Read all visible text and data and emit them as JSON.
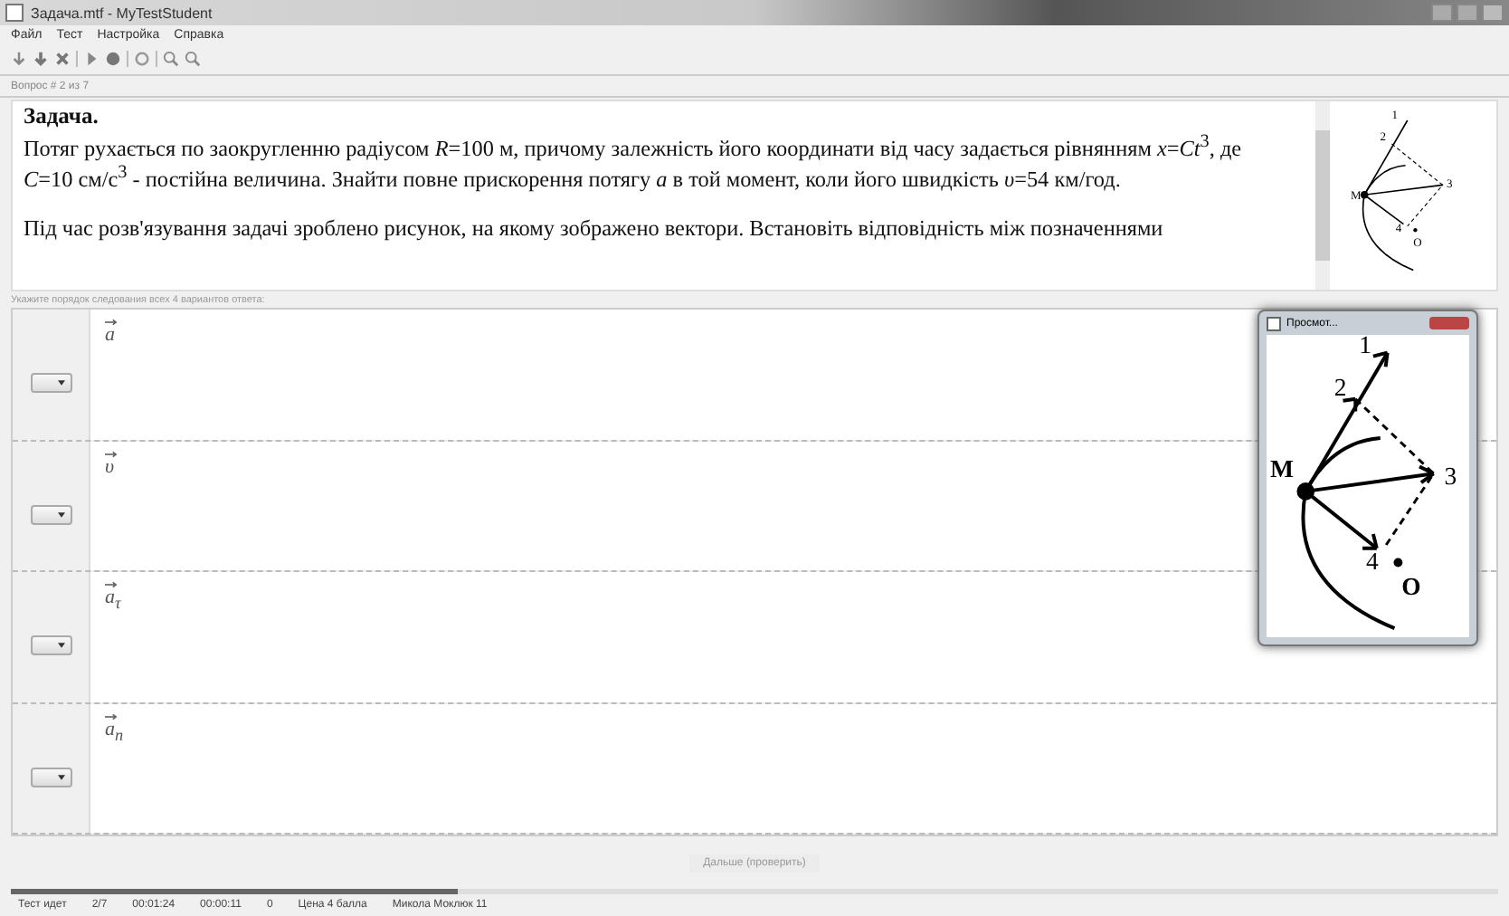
{
  "window": {
    "title": "Задача.mtf - MyTestStudent"
  },
  "menu": [
    "Файл",
    "Тест",
    "Настройка",
    "Справка"
  ],
  "question_label": "Вопрос # 2 из 7",
  "question": {
    "heading": "Задача.",
    "paragraphs": [
      "Потяг рухається по заокругленню радіусом *R*=100 м, причому залежність його координати від часу задається рівнянням *x*=*Ct*$^{3}$, де *C*=10 см/с$^{3}$ - постійна величина. Знайти повне прискорення потягу *a* в той момент, коли його швидкість *υ*=54 км/год.",
      "Під час розв'язування задачі зроблено рисунок, на якому зображено вектори. Встановіть відповідність між позначеннями"
    ],
    "thumbnail_labels": [
      "1",
      "2",
      "3",
      "4",
      "M",
      "O"
    ]
  },
  "instruction": "Укажите порядок следования всех 4 вариантов ответа:",
  "answers": [
    {
      "label": "a",
      "vector": true
    },
    {
      "label": "υ",
      "vector": true
    },
    {
      "label": "a$_{τ}$",
      "vector": true
    },
    {
      "label": "a$_{n}$",
      "vector": true
    }
  ],
  "preview": {
    "title": "Просмот...",
    "labels": [
      "1",
      "2",
      "3",
      "4",
      "M",
      "O"
    ]
  },
  "next_button": "Дальше (проверить)",
  "status_bar": [
    "Тест идет",
    "2/7",
    "00:01:24",
    "00:00:11",
    "0",
    "Цена 4 балла",
    "Микола Моклюк 11"
  ]
}
